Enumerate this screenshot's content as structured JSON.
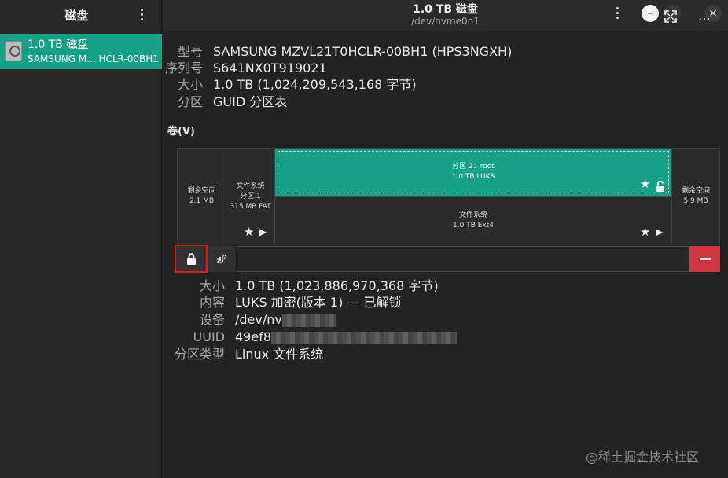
{
  "sidebar": {
    "title": "磁盘",
    "disk": {
      "name": "1.0 TB 磁盘",
      "subtitle": "SAMSUNG M... HCLR-00BH1"
    }
  },
  "header": {
    "title": "1.0 TB 磁盘",
    "subtitle": "/dev/nvme0n1"
  },
  "disk_info": {
    "model_label": "型号",
    "model_value": "SAMSUNG MZVL21T0HCLR-00BH1 (HPS3NGXH)",
    "serial_label": "序列号",
    "serial_value": "S641NX0T919021",
    "size_label": "大小",
    "size_value": "1.0 TB (1,024,209,543,168 字节)",
    "partitioning_label": "分区",
    "partitioning_value": "GUID 分区表"
  },
  "volumes": {
    "title": "卷(V)",
    "segments": {
      "free1": {
        "line1": "剩余空间",
        "line2": "2.1 MB"
      },
      "fat": {
        "line1": "文件系统",
        "line2": "分区 1",
        "line3": "315 MB FAT"
      },
      "luks": {
        "line1": "分区 2：root",
        "line2": "1.0 TB LUKS"
      },
      "ext4": {
        "line1": "文件系统",
        "line2": "1.0 TB Ext4"
      },
      "free2": {
        "line1": "剩余空间",
        "line2": "5.9 MB"
      }
    },
    "mark_star": "★",
    "mark_play": "▶"
  },
  "volume_info": {
    "size_label": "大小",
    "size_value": "1.0 TB (1,023,886,970,368 字节)",
    "contents_label": "内容",
    "contents_value": "LUKS 加密(版本 1) — 已解锁",
    "device_label": "设备",
    "device_value": "/dev/nv",
    "uuid_label": "UUID",
    "uuid_value": "49ef8",
    "ptype_label": "分区类型",
    "ptype_value": "Linux 文件系统"
  },
  "watermark": "@稀土掘金技术社区",
  "colors": {
    "accent": "#16a085",
    "danger": "#d0353f",
    "highlight": "#e01818"
  }
}
